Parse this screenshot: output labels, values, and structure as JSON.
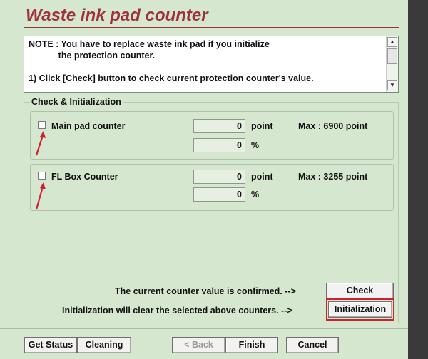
{
  "window": {
    "title": "Waste ink pad counter"
  },
  "note": {
    "lines": [
      "NOTE : You have to replace waste ink pad if you initialize",
      "            the protection counter.",
      "",
      "1) Click [Check] button to check current protection counter's value."
    ]
  },
  "group": {
    "label": "Check & Initialization"
  },
  "counters": [
    {
      "label": "Main pad counter",
      "point_value": "0",
      "point_unit": "point",
      "percent_value": "0",
      "percent_unit": "%",
      "max": "Max : 6900 point"
    },
    {
      "label": "FL Box Counter",
      "point_value": "0",
      "point_unit": "point",
      "percent_value": "0",
      "percent_unit": "%",
      "max": "Max : 3255 point"
    }
  ],
  "actions": {
    "check_message": "The current counter value is confirmed. -->",
    "check_label": "Check",
    "init_message": "Initialization will clear the selected above counters. -->",
    "init_label": "Initialization"
  },
  "footer": {
    "get_status": "Get Status",
    "cleaning": "Cleaning",
    "back": "< Back",
    "finish": "Finish",
    "cancel": "Cancel"
  },
  "colors": {
    "title": "#a0303a",
    "annotation_red": "#d0202a",
    "background": "#d6e7d0"
  }
}
